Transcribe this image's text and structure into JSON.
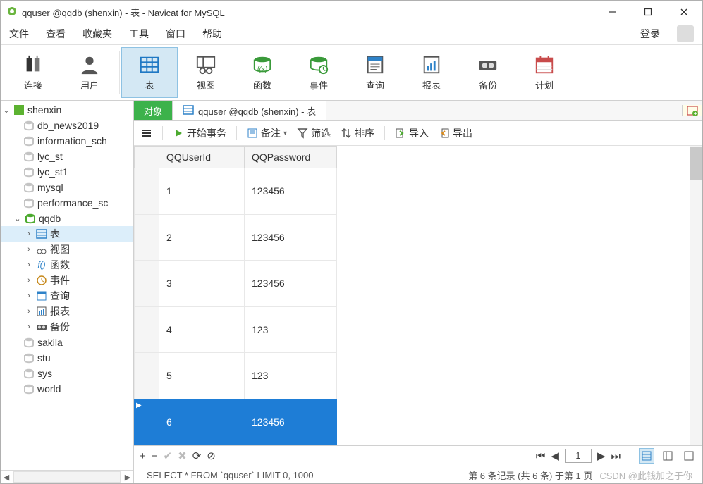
{
  "titlebar": {
    "title": "qquser @qqdb (shenxin) - 表 - Navicat for MySQL"
  },
  "menu": {
    "file": "文件",
    "view": "查看",
    "fav": "收藏夹",
    "tools": "工具",
    "window": "窗口",
    "help": "帮助",
    "login": "登录"
  },
  "toolbar": {
    "connect": "连接",
    "user": "用户",
    "table": "表",
    "view": "视图",
    "function": "函数",
    "event": "事件",
    "query": "查询",
    "report": "报表",
    "backup": "备份",
    "schedule": "计划"
  },
  "tree": {
    "conn": "shenxin",
    "items": [
      "db_news2019",
      "information_sch",
      "lyc_st",
      "lyc_st1",
      "mysql",
      "performance_sc"
    ],
    "openDb": "qqdb",
    "sub": {
      "table": "表",
      "view": "视图",
      "function": "函数",
      "event": "事件",
      "query": "查询",
      "report": "报表",
      "backup": "备份"
    },
    "rest": [
      "sakila",
      "stu",
      "sys",
      "world"
    ]
  },
  "tabs": {
    "object": "对象",
    "current": "qquser @qqdb (shenxin) - 表"
  },
  "subbar": {
    "begin": "开始事务",
    "memo": "备注",
    "filter": "筛选",
    "sort": "排序",
    "import": "导入",
    "export": "导出"
  },
  "grid": {
    "columns": [
      "QQUserId",
      "QQPassword"
    ],
    "rows": [
      {
        "id": "1",
        "pw": "123456"
      },
      {
        "id": "2",
        "pw": "123456"
      },
      {
        "id": "3",
        "pw": "123456"
      },
      {
        "id": "4",
        "pw": "123"
      },
      {
        "id": "5",
        "pw": "123"
      },
      {
        "id": "6",
        "pw": "123456"
      }
    ],
    "selectedIndex": 5
  },
  "pager": {
    "page": "1"
  },
  "status": {
    "sql": "SELECT * FROM `qquser` LIMIT 0, 1000",
    "count": "第 6 条记录  (共 6 条) 于第 1 页",
    "watermark": "CSDN @此钱加之于你"
  }
}
